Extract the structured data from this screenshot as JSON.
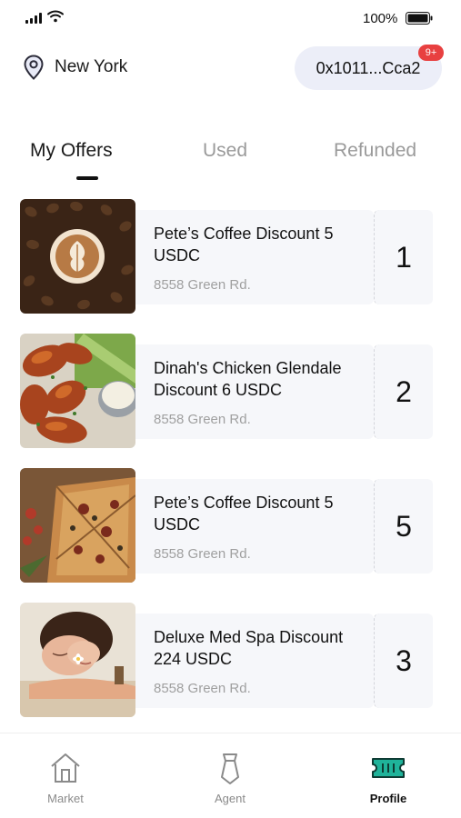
{
  "status": {
    "battery_percent": "100%"
  },
  "location": {
    "city": "New York"
  },
  "wallet": {
    "address": "0x1011...Cca2",
    "notification_badge": "9+"
  },
  "tabs": [
    {
      "label": "My Offers",
      "active": true
    },
    {
      "label": "Used",
      "active": false
    },
    {
      "label": "Refunded",
      "active": false
    }
  ],
  "offers": [
    {
      "title": "Pete’s Coffee Discount 5 USDC",
      "address": "8558 Green Rd.",
      "count": "1",
      "image": "coffee"
    },
    {
      "title": "Dinah's Chicken Glendale Discount 6 USDC",
      "address": "8558 Green Rd.",
      "count": "2",
      "image": "chicken-wings"
    },
    {
      "title": "Pete’s Coffee Discount 5 USDC",
      "address": "8558 Green Rd.",
      "count": "5",
      "image": "pizza"
    },
    {
      "title": "Deluxe Med Spa Discount 224 USDC",
      "address": "8558 Green Rd.",
      "count": "3",
      "image": "spa"
    }
  ],
  "nav": [
    {
      "label": "Market",
      "icon": "house-icon",
      "active": false
    },
    {
      "label": "Agent",
      "icon": "agent-tie-icon",
      "active": false
    },
    {
      "label": "Profile",
      "icon": "ticket-icon",
      "active": true
    }
  ],
  "colors": {
    "accent": "#1fb39a",
    "badge": "#e84040",
    "wallet_bg": "#eceef8"
  }
}
